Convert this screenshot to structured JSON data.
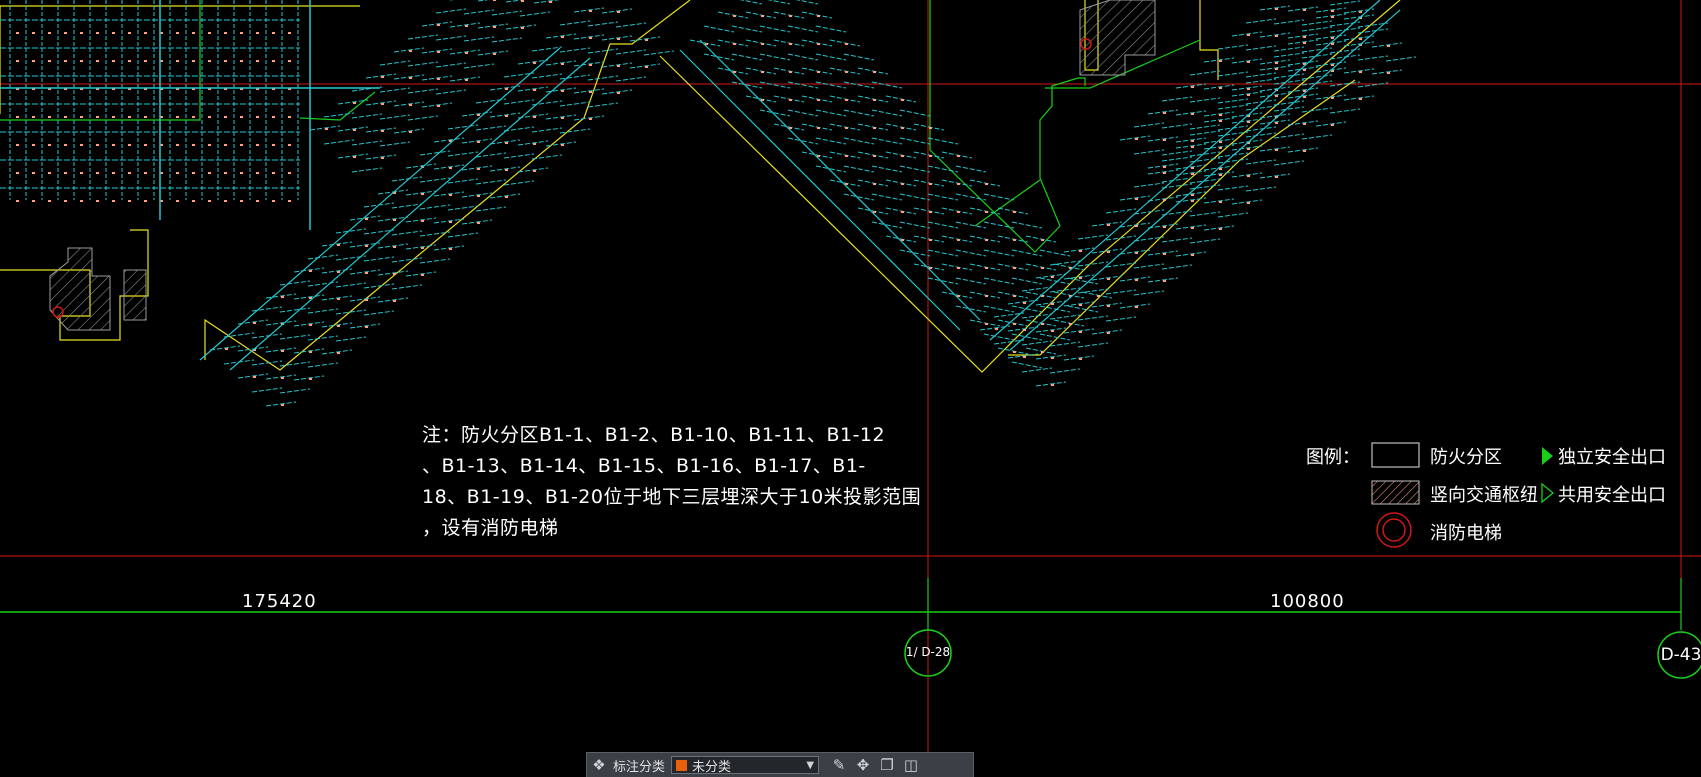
{
  "note": {
    "lines": [
      "注：防火分区B1-1、B1-2、B1-10、B1-11、B1-12",
      "、B1-13、B1-14、B1-15、B1-16、B1-17、B1-",
      "18、B1-19、B1-20位于地下三层埋深大于10米投影范围",
      "，设有消防电梯"
    ]
  },
  "dimensions": {
    "left": "175420",
    "right": "100800"
  },
  "axes": {
    "left": "1/ D-28",
    "right": "D-43"
  },
  "legend": {
    "title": "图例：",
    "fire_zone": "防火分区",
    "vertical_core": "竖向交通枢纽",
    "fire_elevator": "消防电梯",
    "exit_independent": "独立安全出口",
    "exit_shared": "共用安全出口"
  },
  "toolbar": {
    "label": "标注分类",
    "selected": "未分类",
    "swatch_color": "#e8600c"
  },
  "colors": {
    "cyan": "#22c8d0",
    "green": "#18d018",
    "yellow": "#e8e020",
    "red": "#d01818",
    "salmon": "#ff9f80"
  }
}
